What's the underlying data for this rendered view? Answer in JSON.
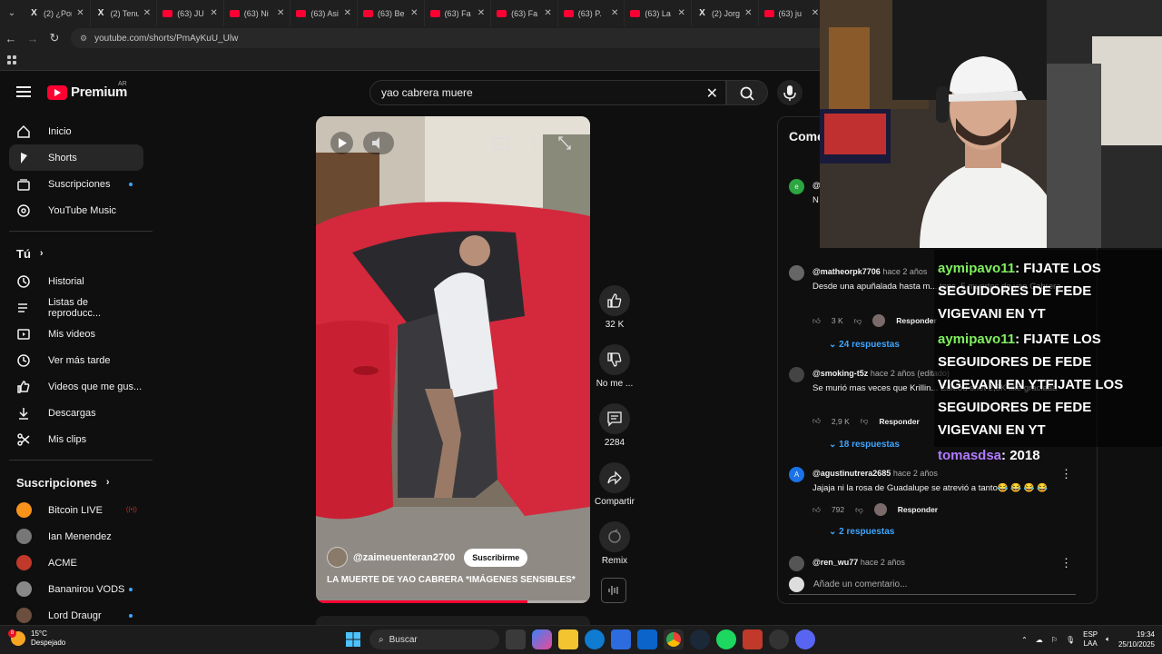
{
  "browser": {
    "tabs": [
      {
        "icon": "x-logo-icon",
        "title": "(2) ¿Por"
      },
      {
        "icon": "x-logo-icon",
        "title": "(2) Tenu"
      },
      {
        "icon": "youtube-icon",
        "title": "(63) JU"
      },
      {
        "icon": "youtube-icon",
        "title": "(63) Ni"
      },
      {
        "icon": "youtube-icon",
        "title": "(63) Asi"
      },
      {
        "icon": "youtube-icon",
        "title": "(63) Be"
      },
      {
        "icon": "youtube-icon",
        "title": "(63) Fa"
      },
      {
        "icon": "youtube-icon",
        "title": "(63) Fa"
      },
      {
        "icon": "youtube-icon",
        "title": "(63) P."
      },
      {
        "icon": "youtube-icon",
        "title": "(63) La"
      },
      {
        "icon": "x-logo-icon",
        "title": "(2) Jorg"
      },
      {
        "icon": "youtube-icon",
        "title": "(63) ju"
      }
    ],
    "url": "youtube.com/shorts/PmAyKuU_Ulw"
  },
  "header": {
    "logo_text": "Premium",
    "country": "AR",
    "search_value": "yao cabrera muere"
  },
  "sidebar": {
    "main": [
      {
        "label": "Inicio",
        "icon": "home-icon",
        "active": false
      },
      {
        "label": "Shorts",
        "icon": "shorts-icon",
        "active": true
      },
      {
        "label": "Suscripciones",
        "icon": "subscriptions-icon",
        "active": false,
        "dot": true
      },
      {
        "label": "YouTube Music",
        "icon": "music-icon",
        "active": false
      }
    ],
    "you_title": "Tú",
    "you": [
      {
        "label": "Historial",
        "icon": "history-icon"
      },
      {
        "label": "Listas de reproducc...",
        "icon": "playlist-icon"
      },
      {
        "label": "Mis videos",
        "icon": "my-videos-icon"
      },
      {
        "label": "Ver más tarde",
        "icon": "watch-later-icon"
      },
      {
        "label": "Videos que me gus...",
        "icon": "liked-icon"
      },
      {
        "label": "Descargas",
        "icon": "download-icon"
      },
      {
        "label": "Mis clips",
        "icon": "clips-icon"
      }
    ],
    "subs_title": "Suscripciones",
    "subs": [
      {
        "label": "Bitcoin LIVE",
        "color": "#f7931a",
        "live": true
      },
      {
        "label": "Ian Menendez",
        "color": "#777777",
        "dot": false
      },
      {
        "label": "ACME",
        "color": "#c0392b",
        "dot": false
      },
      {
        "label": "Bananirou VODS",
        "color": "#888888",
        "dot": true
      },
      {
        "label": "Lord Draugr",
        "color": "#6b4e3d",
        "dot": true
      }
    ]
  },
  "short": {
    "channel": "@zaimeuenteran2700",
    "subscribe": "Suscribirme",
    "title": "LA MUERTE DE YAO CABRERA *IMÁGENES SENSIBLES*",
    "progress": 0.77
  },
  "actions": [
    {
      "name": "like",
      "icon": "thumbs-up-icon",
      "label": "32 K"
    },
    {
      "name": "dislike",
      "icon": "thumbs-down-icon",
      "label": "No me ..."
    },
    {
      "name": "comments",
      "icon": "comment-icon",
      "label": "2284"
    },
    {
      "name": "share",
      "icon": "share-icon",
      "label": "Compartir"
    },
    {
      "name": "remix",
      "icon": "remix-icon",
      "label": "Remix"
    }
  ],
  "comments": {
    "title": "Come",
    "items": [
      {
        "user": "@",
        "time": "",
        "text": "N",
        "likes": "",
        "replies": "",
        "avatar_color": "#2ba640"
      },
      {
        "user": "@matheorpk7706",
        "time": "hace 2 años",
        "text": "Desde una apuñalada hasta m... tops. 5 muertes de yao Cabrera",
        "likes": "3 K",
        "reply": "Responder",
        "replies": "24 respuestas",
        "avatar_color": "#666666"
      },
      {
        "user": "@smoking-t5z",
        "time": "hace 2 años (editado)",
        "text": "Se murió mas veces que Krillin... Edit:ou shet 2,5K like graciaaa",
        "likes": "2,9 K",
        "reply": "Responder",
        "replies": "18 respuestas",
        "avatar_color": "#444444"
      },
      {
        "user": "@agustinutrera2685",
        "time": "hace 2 años",
        "text": "Jajaja ni la rosa de Guadalupe se atrevió a tanto😂 😂 😂 😂",
        "likes": "792",
        "reply": "Responder",
        "replies": "2 respuestas",
        "avatar_color": "#1a73e8"
      },
      {
        "user": "@ren_wu77",
        "time": "hace 2 años",
        "text": "",
        "avatar_color": "#555555"
      }
    ],
    "add_placeholder": "Añade un comentario..."
  },
  "chat": [
    {
      "user": "aymipavo11",
      "msg": ": FIJATE LOS SEGUIDORES DE FEDE VIGEVANI EN YT"
    },
    {
      "user": "aymipavo11",
      "msg": ": FIJATE LOS SEGUIDORES DE FEDE VIGEVANI EN YTFIJATE LOS SEGUIDORES DE FEDE VIGEVANI EN YT"
    },
    {
      "user": "tomasdsa",
      "msg": ": 2018"
    }
  ],
  "taskbar": {
    "temp": "15°C",
    "weather": "Despejado",
    "search": "Buscar",
    "lang1": "ESP",
    "lang2": "LAA",
    "time": "19:34",
    "date": "25/10/2025",
    "weather_badge": "8"
  }
}
